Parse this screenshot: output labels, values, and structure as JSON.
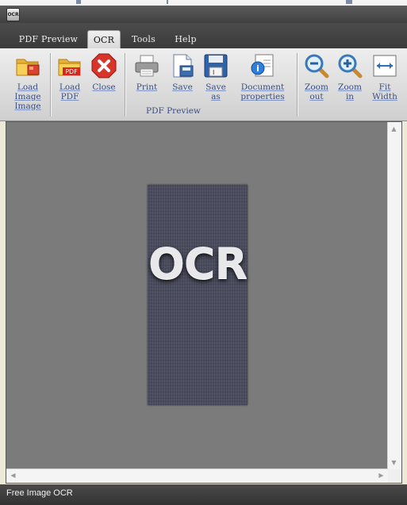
{
  "window": {
    "app_icon_text": "OCR",
    "status_text": "Free Image OCR"
  },
  "tabs": [
    {
      "label": "PDF Preview",
      "active": false
    },
    {
      "label": "OCR",
      "active": true
    },
    {
      "label": "Tools",
      "active": false
    },
    {
      "label": "Help",
      "active": false
    }
  ],
  "ribbon": {
    "group_label": "PDF Preview",
    "buttons": {
      "load_image": {
        "line1": "Load",
        "line2": "Image",
        "line3": "Image",
        "icon": "folder-image-icon"
      },
      "load_pdf": {
        "line1": "Load",
        "line2": "PDF",
        "icon": "folder-pdf-icon"
      },
      "close": {
        "line1": "Close",
        "icon": "close-icon"
      },
      "print": {
        "line1": "Print",
        "icon": "printer-icon"
      },
      "save": {
        "line1": "Save",
        "icon": "save-icon"
      },
      "save_as": {
        "line1": "Save",
        "line2": "as",
        "icon": "save-as-icon"
      },
      "doc_props": {
        "line1": "Document",
        "line2": "properties",
        "icon": "document-properties-icon"
      },
      "zoom_out": {
        "line1": "Zoom",
        "line2": "out",
        "icon": "zoom-out-icon"
      },
      "zoom_in": {
        "line1": "Zoom",
        "line2": "in",
        "icon": "zoom-in-icon"
      },
      "fit_width": {
        "line1": "Fit",
        "line2": "Width",
        "icon": "fit-width-icon"
      }
    },
    "pdf_badge": "PDF"
  },
  "viewer": {
    "page_text": "OCR"
  },
  "colors": {
    "accent_text": "#3a4f86",
    "viewer_bg": "#7b7b7b",
    "page_bg": "#4a4b5d",
    "close_red": "#d9342b"
  }
}
